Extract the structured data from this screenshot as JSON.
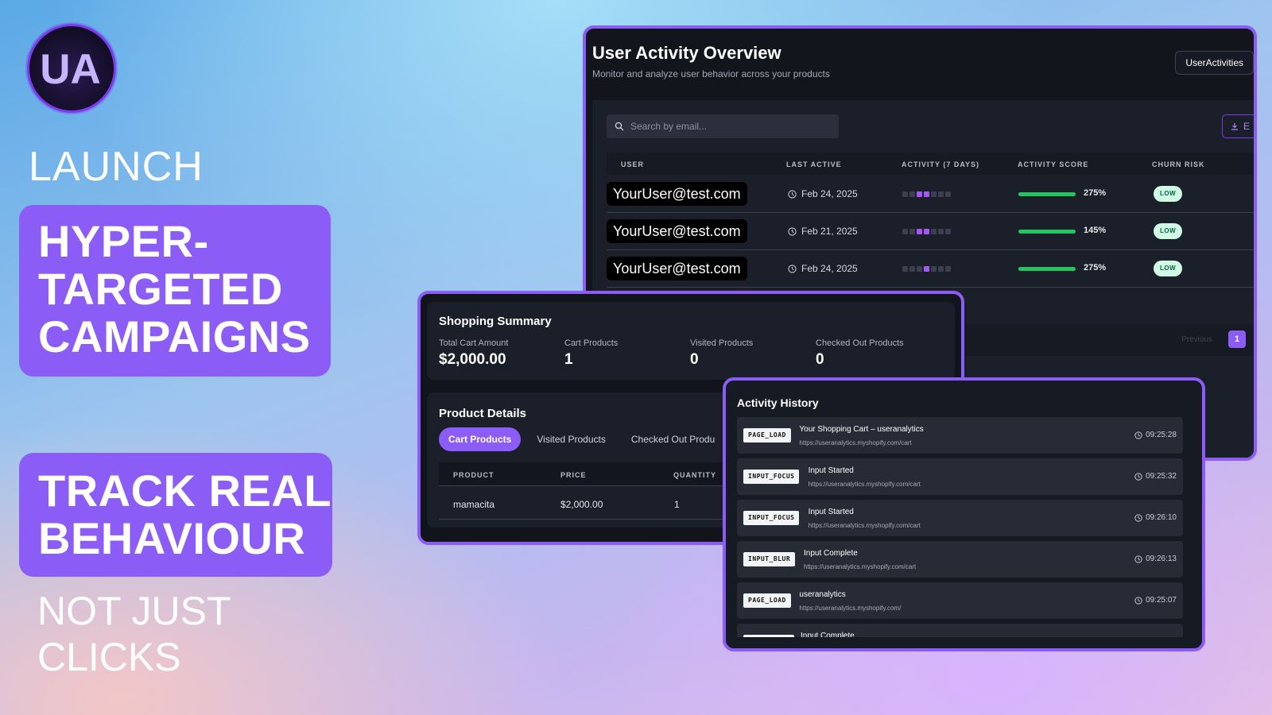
{
  "brand": {
    "logo_text": "UA",
    "accent": "#8b5cf6"
  },
  "hero": {
    "launch": "LAUNCH",
    "campaign_lines": [
      "HYPER-",
      "TARGETED",
      "CAMPAIGNS"
    ],
    "track_lines": [
      "TRACK REAL",
      "BEHAVIOUR"
    ],
    "not_just_lines": [
      "NOT JUST",
      "CLICKS"
    ]
  },
  "overview": {
    "title": "User Activity Overview",
    "subtitle": "Monitor and analyze user behavior across your products",
    "top_button": "UserActivities",
    "search_placeholder": "Search by email...",
    "export_label": "E",
    "columns": [
      "USER",
      "LAST ACTIVE",
      "ACTIVITY (7 DAYS)",
      "ACTIVITY SCORE",
      "CHURN RISK"
    ],
    "rows": [
      {
        "email": "YourUser@test.com",
        "last_active": "Feb 24, 2025",
        "activity": [
          0,
          0,
          1,
          1,
          0,
          0,
          0
        ],
        "score_fraction": 1.0,
        "score": "275%",
        "churn": "LOW"
      },
      {
        "email": "YourUser@test.com",
        "last_active": "Feb 21, 2025",
        "activity": [
          0,
          0,
          1,
          1,
          0,
          0,
          0
        ],
        "score_fraction": 1.0,
        "score": "145%",
        "churn": "LOW"
      },
      {
        "email": "YourUser@test.com",
        "last_active": "Feb 24, 2025",
        "activity": [
          0,
          0,
          0,
          1,
          0,
          0,
          0
        ],
        "score_fraction": 1.0,
        "score": "275%",
        "churn": "LOW"
      }
    ],
    "pager": {
      "prev": "Previous",
      "page": "1"
    }
  },
  "shopping": {
    "title": "Shopping Summary",
    "stats": [
      {
        "label": "Total Cart Amount",
        "value": "$2,000.00"
      },
      {
        "label": "Cart Products",
        "value": "1"
      },
      {
        "label": "Visited Products",
        "value": "0"
      },
      {
        "label": "Checked Out Products",
        "value": "0"
      }
    ],
    "details_title": "Product Details",
    "tabs": [
      "Cart Products",
      "Visited Products",
      "Checked Out Produ"
    ],
    "columns": [
      "PRODUCT",
      "PRICE",
      "QUANTITY"
    ],
    "row": {
      "product": "mamacita",
      "price": "$2,000.00",
      "quantity": "1"
    }
  },
  "history": {
    "title": "Activity History",
    "items": [
      {
        "event": "PAGE_LOAD",
        "name": "Your Shopping Cart – useranalytics",
        "url": "https://useranalytics.myshopify.com/cart",
        "time": "09:25:28"
      },
      {
        "event": "INPUT_FOCUS",
        "name": "Input Started",
        "url": "https://useranalytics.myshopify.com/cart",
        "time": "09:25:32"
      },
      {
        "event": "INPUT_FOCUS",
        "name": "Input Started",
        "url": "https://useranalytics.myshopify.com/cart",
        "time": "09:26:10"
      },
      {
        "event": "INPUT_BLUR",
        "name": "Input Complete",
        "url": "https://useranalytics.myshopify.com/cart",
        "time": "09:26:13"
      },
      {
        "event": "PAGE_LOAD",
        "name": "useranalytics",
        "url": "https://useranalytics.myshopify.com/",
        "time": "09:25:07"
      },
      {
        "event": "",
        "name": "Input Complete",
        "url": "",
        "time": ""
      }
    ]
  }
}
